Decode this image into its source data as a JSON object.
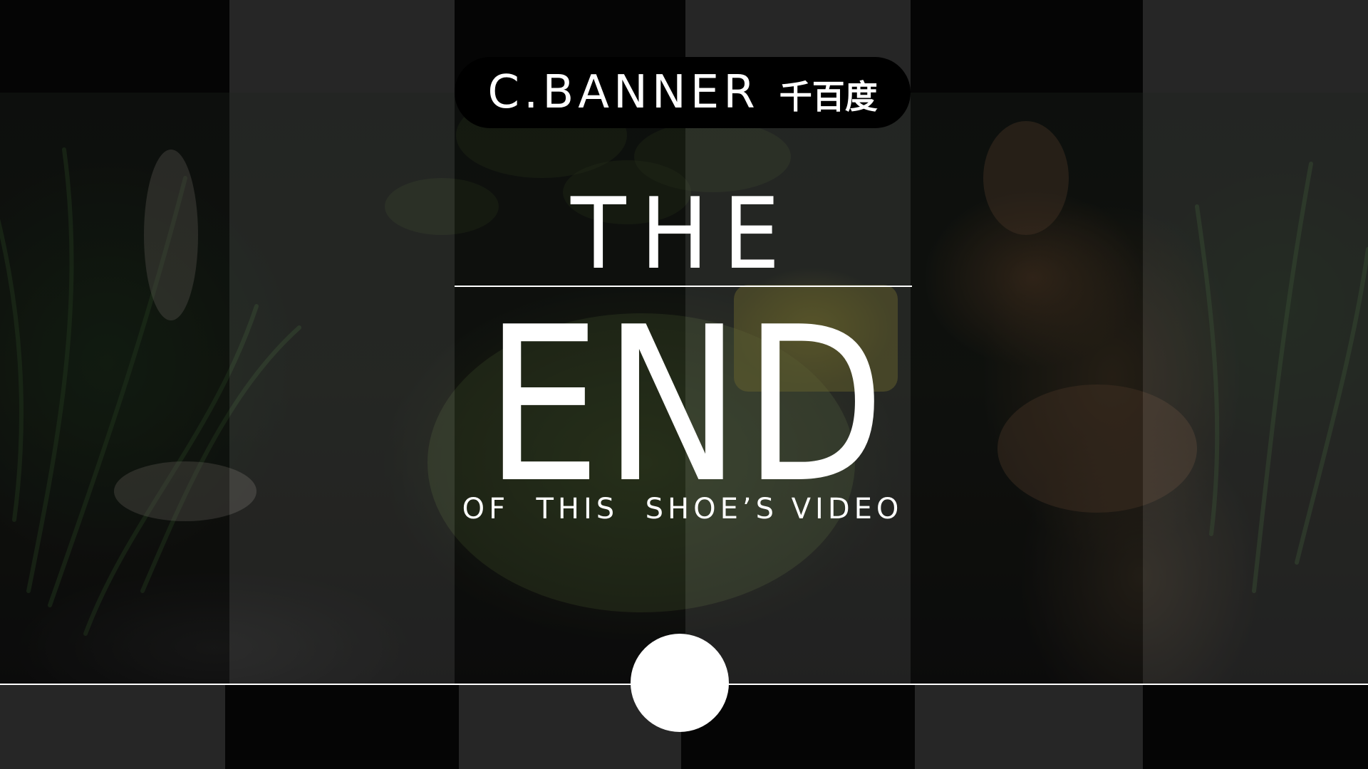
{
  "brand": {
    "name_latin": "C.BANNER",
    "name_cjk": "千百度"
  },
  "title": {
    "line1": "THE",
    "line2": "END",
    "subtitle": "OF  THIS  SHOE’S VIDEO"
  },
  "colors": {
    "text": "#ffffff",
    "pill_background": "#000000",
    "stripe_dark": "#050505",
    "stripe_light": "#262626"
  }
}
